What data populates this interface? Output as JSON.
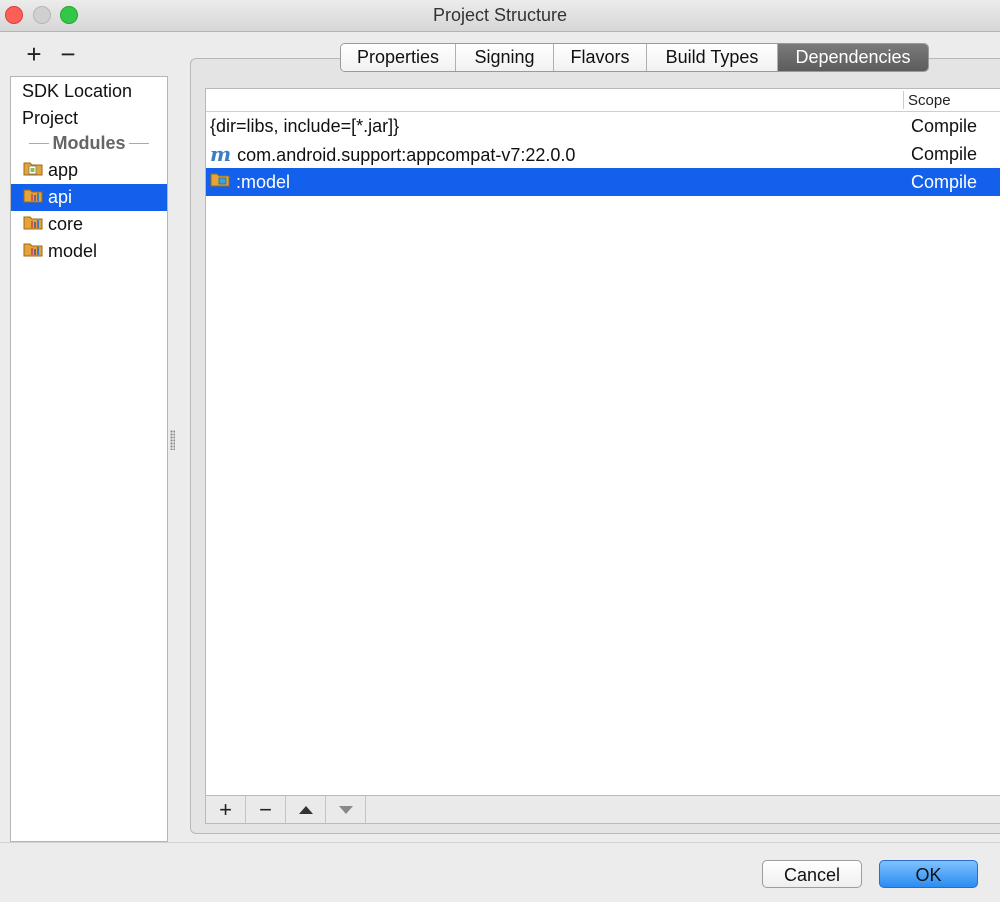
{
  "window": {
    "title": "Project Structure"
  },
  "left": {
    "add_label": "+",
    "remove_label": "−",
    "top_items": [
      {
        "label": "SDK Location"
      },
      {
        "label": "Project"
      }
    ],
    "modules_header": "Modules",
    "modules": [
      {
        "label": "app",
        "icon": "android-module-icon",
        "selected": false
      },
      {
        "label": "api",
        "icon": "library-module-icon",
        "selected": true
      },
      {
        "label": "core",
        "icon": "library-module-icon",
        "selected": false
      },
      {
        "label": "model",
        "icon": "library-module-icon",
        "selected": false
      }
    ]
  },
  "tabs": [
    {
      "label": "Properties",
      "active": false
    },
    {
      "label": "Signing",
      "active": false
    },
    {
      "label": "Flavors",
      "active": false
    },
    {
      "label": "Build Types",
      "active": false
    },
    {
      "label": "Dependencies",
      "active": true
    }
  ],
  "table": {
    "columns": [
      "",
      "Scope"
    ],
    "rows": [
      {
        "name": "{dir=libs, include=[*.jar]}",
        "scope": "Compile",
        "icon": "",
        "selected": false
      },
      {
        "name": "com.android.support:appcompat-v7:22.0.0",
        "scope": "Compile",
        "icon": "maven-icon",
        "selected": false
      },
      {
        "name": ":model",
        "scope": "Compile",
        "icon": "module-folder-icon",
        "selected": true
      }
    ],
    "toolbar": {
      "add": "+",
      "remove": "−"
    }
  },
  "footer": {
    "cancel_label": "Cancel",
    "ok_label": "OK"
  },
  "colors": {
    "selection": "#1360ec",
    "ok_button": "#2b8cf3",
    "active_tab": "#5c5c5c"
  }
}
